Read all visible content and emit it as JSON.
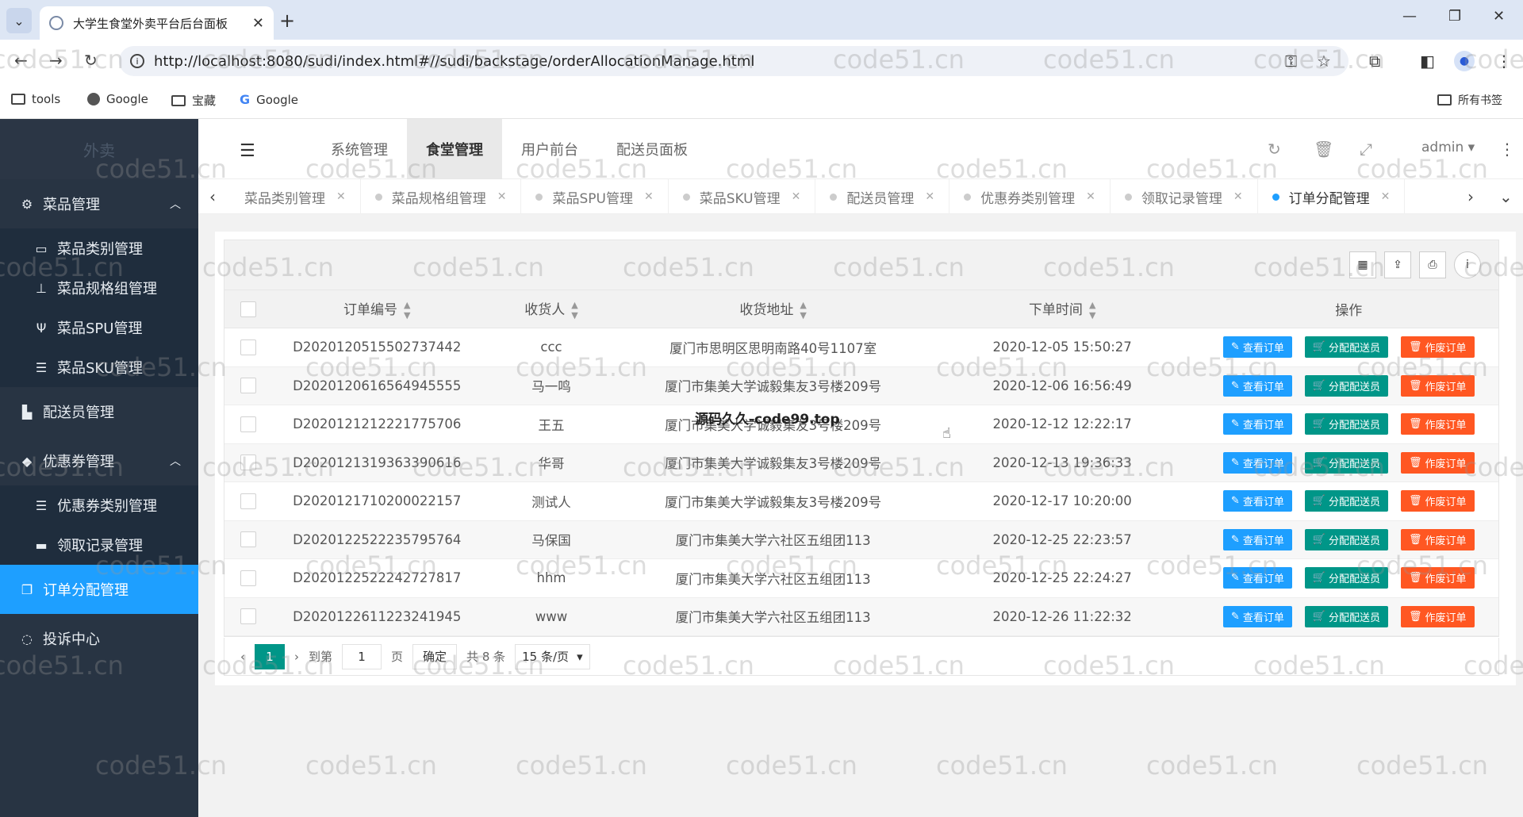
{
  "browser": {
    "tab_title": "大学生食堂外卖平台后台面板",
    "url": "http://localhost:8080/sudi/index.html#//sudi/backstage/orderAllocationManage.html",
    "bookmarks": [
      "tools",
      "Google",
      "宝藏",
      "Google"
    ],
    "all_bookmarks": "所有书签"
  },
  "app": {
    "logo": "外卖",
    "top_nav": [
      "系统管理",
      "食堂管理",
      "用户前台",
      "配送员面板"
    ],
    "top_nav_active": 1,
    "user": "admin"
  },
  "sidebar": {
    "groups": [
      {
        "label": "菜品管理",
        "icon": "gears-icon",
        "expanded": true
      },
      {
        "label": "配送员管理",
        "icon": "truck-icon"
      },
      {
        "label": "优惠券管理",
        "icon": "tag-icon",
        "expanded": true
      },
      {
        "label": "订单分配管理",
        "icon": "order-icon",
        "active": true
      },
      {
        "label": "投诉中心",
        "icon": "chat-icon"
      }
    ],
    "dish_items": [
      "菜品类别管理",
      "菜品规格组管理",
      "菜品SPU管理",
      "菜品SKU管理"
    ],
    "coupon_items": [
      "优惠券类别管理",
      "领取记录管理"
    ]
  },
  "page_tabs": [
    "菜品类别管理",
    "菜品规格组管理",
    "菜品SPU管理",
    "菜品SKU管理",
    "配送员管理",
    "优惠券类别管理",
    "领取记录管理",
    "订单分配管理"
  ],
  "table": {
    "headers": [
      "订单编号",
      "收货人",
      "收货地址",
      "下单时间",
      "操作"
    ],
    "rows": [
      {
        "no": "D2020120515502737442",
        "name": "ccc",
        "addr": "厦门市思明区思明南路40号1107室",
        "time": "2020-12-05 15:50:27"
      },
      {
        "no": "D2020120616564945555",
        "name": "马一鸣",
        "addr": "厦门市集美大学诚毅集友3号楼209号",
        "time": "2020-12-06 16:56:49"
      },
      {
        "no": "D2020121212221775706",
        "name": "王五",
        "addr": "厦门市集美大学诚毅集友3号楼209号",
        "time": "2020-12-12 12:22:17"
      },
      {
        "no": "D2020121319363390616",
        "name": "华哥",
        "addr": "厦门市集美大学诚毅集友3号楼209号",
        "time": "2020-12-13 19:36:33"
      },
      {
        "no": "D2020121710200022157",
        "name": "测试人",
        "addr": "厦门市集美大学诚毅集友3号楼209号",
        "time": "2020-12-17 10:20:00"
      },
      {
        "no": "D2020122522235795764",
        "name": "马保国",
        "addr": "厦门市集美大学六社区五组团113",
        "time": "2020-12-25 22:23:57"
      },
      {
        "no": "D2020122522242727817",
        "name": "hhm",
        "addr": "厦门市集美大学六社区五组团113",
        "time": "2020-12-25 22:24:27"
      },
      {
        "no": "D2020122611223241945",
        "name": "www",
        "addr": "厦门市集美大学六社区五组团113",
        "time": "2020-12-26 11:22:32"
      }
    ],
    "actions": {
      "view": "查看订单",
      "assign": "分配配送员",
      "void": "作废订单"
    }
  },
  "pager": {
    "current": "1",
    "goto_label": "到第",
    "goto_value": "1",
    "page_label": "页",
    "confirm": "确定",
    "total": "共 8 条",
    "per_page": "15 条/页"
  },
  "overlay": "源码久久-code99.top",
  "watermark": "code51.cn"
}
